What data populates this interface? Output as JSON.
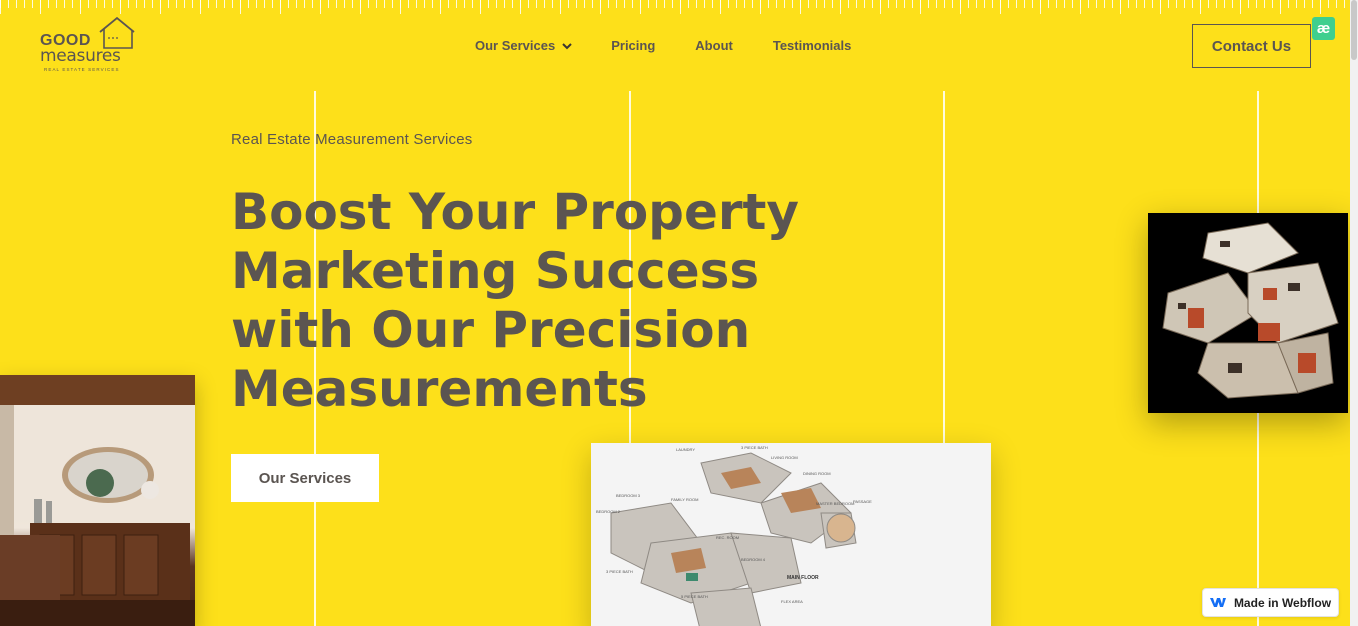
{
  "header": {
    "logo": {
      "word1": "GOOD",
      "word2": "measures",
      "tagline": "REAL ESTATE SERVICES"
    },
    "nav": [
      {
        "label": "Our Services",
        "has_dropdown": true
      },
      {
        "label": "Pricing"
      },
      {
        "label": "About"
      },
      {
        "label": "Testimonials"
      }
    ],
    "contact_label": "Contact Us",
    "ae_badge": "æ"
  },
  "hero": {
    "eyebrow": "Real Estate Measurement Services",
    "headline_lines": [
      "Boost Your Property",
      "Marketing Success",
      "with Our Precision",
      "Measurements"
    ],
    "cta_label": "Our Services"
  },
  "floor_plan_labels": {
    "main_floor": "MAIN FLOOR"
  },
  "webflow_badge": "Made in Webflow",
  "colors": {
    "background": "#fde01a",
    "text": "#5b5551",
    "white": "#ffffff",
    "badge_green": "#3fcf8e",
    "webflow_blue": "#146ef5"
  }
}
